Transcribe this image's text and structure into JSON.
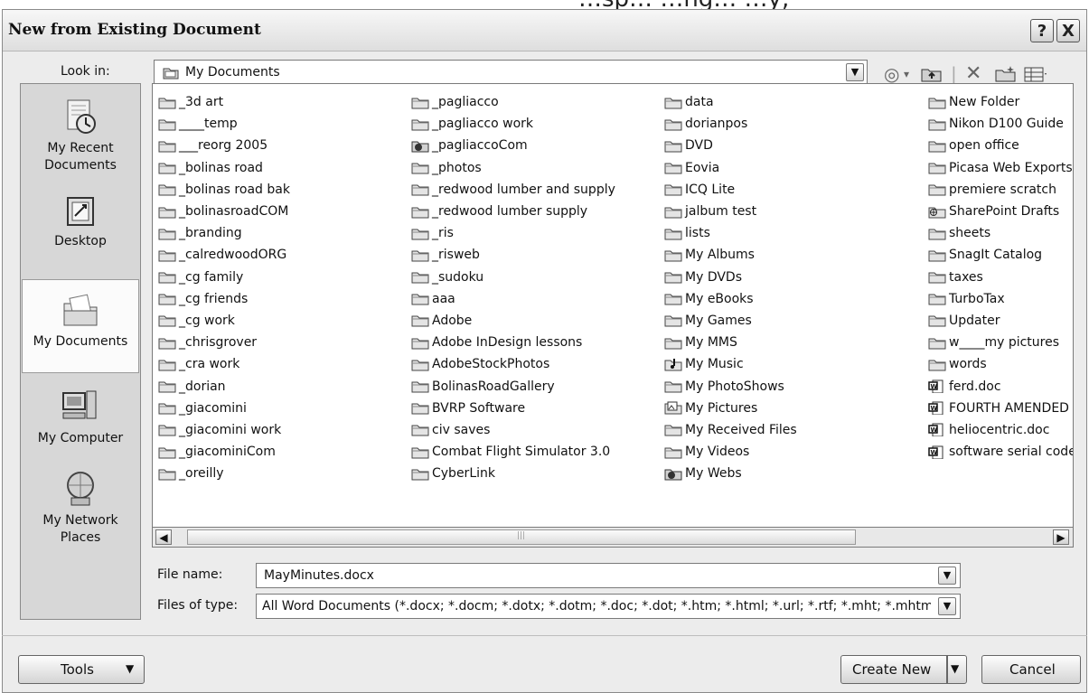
{
  "window": {
    "title": "New from Existing Document",
    "help_label": "?",
    "close_label": "X"
  },
  "lookin": {
    "label": "Look in:",
    "value": "My Documents"
  },
  "toolbar_icons": [
    "back-icon",
    "up-folder-icon",
    "delete-icon",
    "new-folder-icon",
    "views-icon"
  ],
  "places": [
    {
      "label": "My Recent\nDocuments",
      "icon": "recent-icon"
    },
    {
      "label": "Desktop",
      "icon": "desktop-icon"
    },
    {
      "label": "My Documents",
      "icon": "my-documents-icon",
      "selected": true
    },
    {
      "label": "My Computer",
      "icon": "computer-icon"
    },
    {
      "label": "My Network\nPlaces",
      "icon": "network-icon"
    }
  ],
  "files": {
    "columns": [
      [
        {
          "name": "_3d art",
          "type": "folder"
        },
        {
          "name": "____temp",
          "type": "folder"
        },
        {
          "name": "___reorg 2005",
          "type": "folder"
        },
        {
          "name": "_bolinas road",
          "type": "folder"
        },
        {
          "name": "_bolinas road bak",
          "type": "folder"
        },
        {
          "name": "_bolinasroadCOM",
          "type": "folder"
        },
        {
          "name": "_branding",
          "type": "folder"
        },
        {
          "name": "_calredwoodORG",
          "type": "folder"
        },
        {
          "name": "_cg family",
          "type": "folder"
        },
        {
          "name": "_cg friends",
          "type": "folder"
        },
        {
          "name": "_cg work",
          "type": "folder"
        },
        {
          "name": "_chrisgrover",
          "type": "folder"
        },
        {
          "name": "_cra work",
          "type": "folder"
        },
        {
          "name": "_dorian",
          "type": "folder"
        },
        {
          "name": "_giacomini",
          "type": "folder"
        },
        {
          "name": "_giacomini work",
          "type": "folder"
        },
        {
          "name": "_giacominiCom",
          "type": "folder"
        },
        {
          "name": "_oreilly",
          "type": "folder"
        }
      ],
      [
        {
          "name": "_pagliacco",
          "type": "folder"
        },
        {
          "name": "_pagliacco work",
          "type": "folder"
        },
        {
          "name": "_pagliaccoCom",
          "type": "web"
        },
        {
          "name": "_photos",
          "type": "folder"
        },
        {
          "name": "_redwood lumber and supply",
          "type": "folder"
        },
        {
          "name": "_redwood lumber supply",
          "type": "folder"
        },
        {
          "name": "_ris",
          "type": "folder"
        },
        {
          "name": "_risweb",
          "type": "folder"
        },
        {
          "name": "_sudoku",
          "type": "folder"
        },
        {
          "name": "aaa",
          "type": "folder"
        },
        {
          "name": "Adobe",
          "type": "folder"
        },
        {
          "name": "Adobe InDesign lessons",
          "type": "folder"
        },
        {
          "name": "AdobeStockPhotos",
          "type": "folder"
        },
        {
          "name": "BolinasRoadGallery",
          "type": "folder"
        },
        {
          "name": "BVRP Software",
          "type": "folder"
        },
        {
          "name": "civ saves",
          "type": "folder"
        },
        {
          "name": "Combat Flight Simulator 3.0",
          "type": "folder"
        },
        {
          "name": "CyberLink",
          "type": "folder"
        }
      ],
      [
        {
          "name": "data",
          "type": "folder"
        },
        {
          "name": "dorianpos",
          "type": "folder"
        },
        {
          "name": "DVD",
          "type": "folder"
        },
        {
          "name": "Eovia",
          "type": "folder"
        },
        {
          "name": "ICQ Lite",
          "type": "folder"
        },
        {
          "name": "jalbum test",
          "type": "folder"
        },
        {
          "name": "lists",
          "type": "folder"
        },
        {
          "name": "My Albums",
          "type": "folder"
        },
        {
          "name": "My DVDs",
          "type": "folder"
        },
        {
          "name": "My eBooks",
          "type": "folder"
        },
        {
          "name": "My Games",
          "type": "folder"
        },
        {
          "name": "My MMS",
          "type": "folder"
        },
        {
          "name": "My Music",
          "type": "music"
        },
        {
          "name": "My PhotoShows",
          "type": "folder"
        },
        {
          "name": "My Pictures",
          "type": "pictures"
        },
        {
          "name": "My Received Files",
          "type": "folder"
        },
        {
          "name": "My Videos",
          "type": "folder"
        },
        {
          "name": "My Webs",
          "type": "web"
        }
      ],
      [
        {
          "name": "New Folder",
          "type": "folder"
        },
        {
          "name": "Nikon D100 Guide",
          "type": "folder"
        },
        {
          "name": "open office",
          "type": "folder"
        },
        {
          "name": "Picasa Web Exports",
          "type": "folder"
        },
        {
          "name": "premiere scratch",
          "type": "folder"
        },
        {
          "name": "SharePoint Drafts",
          "type": "sharepoint"
        },
        {
          "name": "sheets",
          "type": "folder"
        },
        {
          "name": "SnagIt Catalog",
          "type": "folder"
        },
        {
          "name": "taxes",
          "type": "folder"
        },
        {
          "name": "TurboTax",
          "type": "folder"
        },
        {
          "name": "Updater",
          "type": "folder"
        },
        {
          "name": "w____my pictures",
          "type": "folder"
        },
        {
          "name": "words",
          "type": "folder"
        },
        {
          "name": "ferd.doc",
          "type": "doc"
        },
        {
          "name": "FOURTH AMENDED",
          "type": "doc"
        },
        {
          "name": "heliocentric.doc",
          "type": "doc"
        },
        {
          "name": "software serial codes",
          "type": "doc"
        }
      ]
    ]
  },
  "filename": {
    "label": "File name:",
    "value": "MayMinutes.docx"
  },
  "filetype": {
    "label": "Files of type:",
    "value": "All Word Documents (*.docx; *.docm; *.dotx; *.dotm; *.doc; *.dot; *.htm; *.html; *.url; *.rtf; *.mht; *.mhtml; *.xml)"
  },
  "buttons": {
    "tools": "Tools",
    "create_new": "Create New",
    "cancel": "Cancel"
  },
  "top_strip_text": "…sp… …ng… …y,"
}
